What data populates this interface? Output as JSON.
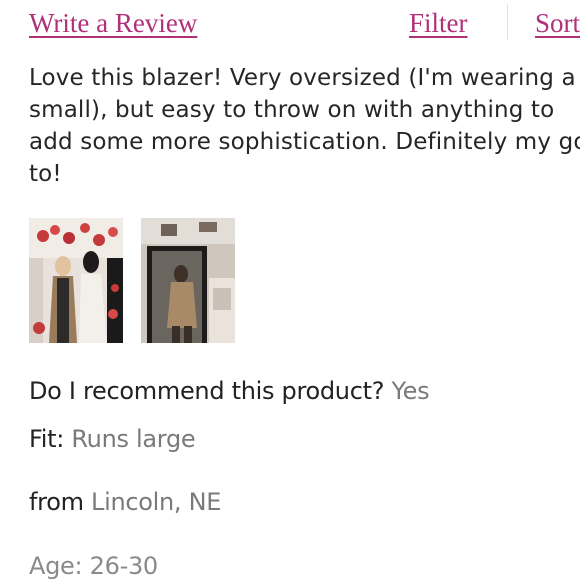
{
  "toolbar": {
    "write_review": "Write a Review",
    "filter": "Filter",
    "sort": "Sort"
  },
  "review": {
    "text": "Love this blazer! Very oversized (I'm wearing a small), but easy to throw on with anything to add some more sophistication. Definitely my go to!",
    "photos": [
      {
        "icon": "review-photo"
      },
      {
        "icon": "review-photo"
      }
    ]
  },
  "details": {
    "recommend_label": "Do I recommend this product?",
    "recommend_value": "Yes",
    "fit_label": "Fit:",
    "fit_value": "Runs large",
    "from_label": "from",
    "from_value": "Lincoln, NE",
    "age_label": "Age:",
    "age_value": "26-30"
  },
  "colors": {
    "link": "#b0307a",
    "text": "#262626",
    "value": "#7a7a7a"
  }
}
